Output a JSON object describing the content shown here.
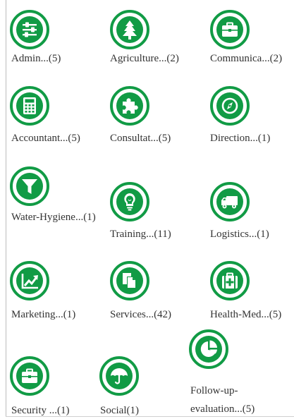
{
  "theme": {
    "accent": "#119b45"
  },
  "categories": [
    {
      "label": "Admin...(5)",
      "icon": "sliders-icon"
    },
    {
      "label": "Agriculture...(2)",
      "icon": "tree-icon"
    },
    {
      "label": "Communica...(2)",
      "icon": "briefcase-icon"
    },
    {
      "label": "Accountant...(5)",
      "icon": "calculator-icon"
    },
    {
      "label": "Consultat...(5)",
      "icon": "puzzle-icon"
    },
    {
      "label": "Direction...(1)",
      "icon": "compass-icon"
    },
    {
      "label": "Water-Hygiene...(1)",
      "icon": "filter-icon"
    },
    {
      "label": "Training...(11)",
      "icon": "lightbulb-icon"
    },
    {
      "label": "Logistics...(1)",
      "icon": "truck-icon"
    },
    {
      "label": "Marketing...(1)",
      "icon": "trend-chart-icon"
    },
    {
      "label": "Services...(42)",
      "icon": "documents-icon"
    },
    {
      "label": "Health-Med...(5)",
      "icon": "medical-kit-icon"
    },
    {
      "label": "Security ...(1)",
      "icon": "briefcase-icon"
    },
    {
      "label": "Social(1)",
      "icon": "umbrella-icon"
    },
    {
      "label": "Follow-up-evaluation...(5)",
      "icon": "pie-chart-icon"
    }
  ]
}
